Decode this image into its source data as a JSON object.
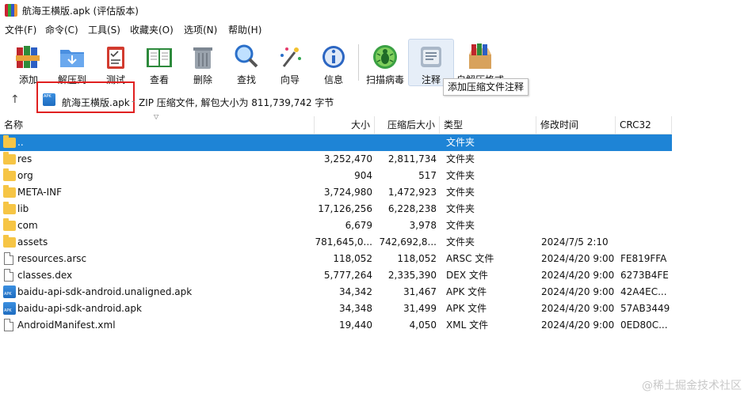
{
  "window": {
    "title": "航海王横版.apk (评估版本)"
  },
  "menu": [
    "文件(F)",
    "命令(C)",
    "工具(S)",
    "收藏夹(O)",
    "选项(N)",
    "帮助(H)"
  ],
  "toolbar": {
    "add": "添加",
    "extract": "解压到",
    "test": "测试",
    "view": "查看",
    "delete": "删除",
    "find": "查找",
    "wizard": "向导",
    "info": "信息",
    "scan": "扫描病毒",
    "comment": "注释",
    "sfx": "自解压格式"
  },
  "tooltip": "添加压缩文件注释",
  "address": {
    "name": "航海王横版.apk",
    "info": "ZIP 压缩文件, 解包大小为 811,739,742 字节"
  },
  "columns": {
    "name": "名称",
    "size": "大小",
    "packed": "压缩后大小",
    "type": "类型",
    "modified": "修改时间",
    "crc": "CRC32"
  },
  "files": [
    {
      "name": "..",
      "size": "",
      "packed": "",
      "type": "文件夹",
      "modified": "",
      "crc": "",
      "icon": "folder",
      "selected": true
    },
    {
      "name": "res",
      "size": "3,252,470",
      "packed": "2,811,734",
      "type": "文件夹",
      "modified": "",
      "crc": "",
      "icon": "folder"
    },
    {
      "name": "org",
      "size": "904",
      "packed": "517",
      "type": "文件夹",
      "modified": "",
      "crc": "",
      "icon": "folder"
    },
    {
      "name": "META-INF",
      "size": "3,724,980",
      "packed": "1,472,923",
      "type": "文件夹",
      "modified": "",
      "crc": "",
      "icon": "folder"
    },
    {
      "name": "lib",
      "size": "17,126,256",
      "packed": "6,228,238",
      "type": "文件夹",
      "modified": "",
      "crc": "",
      "icon": "folder"
    },
    {
      "name": "com",
      "size": "6,679",
      "packed": "3,978",
      "type": "文件夹",
      "modified": "",
      "crc": "",
      "icon": "folder"
    },
    {
      "name": "assets",
      "size": "781,645,0...",
      "packed": "742,692,8...",
      "type": "文件夹",
      "modified": "2024/7/5 2:10",
      "crc": "",
      "icon": "folder"
    },
    {
      "name": "resources.arsc",
      "size": "118,052",
      "packed": "118,052",
      "type": "ARSC 文件",
      "modified": "2024/4/20 9:00",
      "crc": "FE819FFA",
      "icon": "file"
    },
    {
      "name": "classes.dex",
      "size": "5,777,264",
      "packed": "2,335,390",
      "type": "DEX 文件",
      "modified": "2024/4/20 9:00",
      "crc": "6273B4FE",
      "icon": "file"
    },
    {
      "name": "baidu-api-sdk-android.unaligned.apk",
      "size": "34,342",
      "packed": "31,467",
      "type": "APK 文件",
      "modified": "2024/4/20 9:00",
      "crc": "42A4EC...",
      "icon": "apk"
    },
    {
      "name": "baidu-api-sdk-android.apk",
      "size": "34,348",
      "packed": "31,499",
      "type": "APK 文件",
      "modified": "2024/4/20 9:00",
      "crc": "57AB3449",
      "icon": "apk"
    },
    {
      "name": "AndroidManifest.xml",
      "size": "19,440",
      "packed": "4,050",
      "type": "XML 文件",
      "modified": "2024/4/20 9:00",
      "crc": "0ED80C...",
      "icon": "file"
    }
  ],
  "watermark": "@稀土掘金技术社区"
}
